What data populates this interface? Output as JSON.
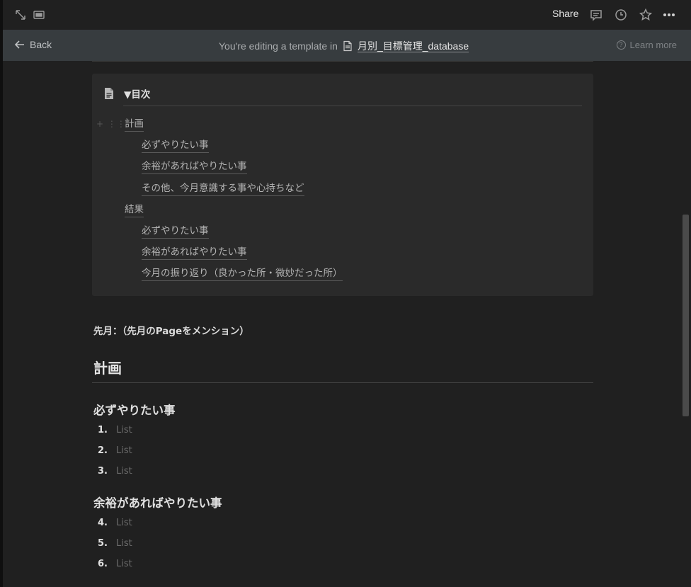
{
  "topbar": {
    "share_label": "Share",
    "icons": [
      "expand-icon",
      "peek-mode-icon",
      "comment-icon",
      "clock-icon",
      "star-icon",
      "more-icon"
    ]
  },
  "banner": {
    "back_label": "Back",
    "editing_text": "You're editing a template in",
    "database_name": "月別_目標管理_database",
    "learn_more": "Learn more"
  },
  "toc": {
    "title": "▼目次",
    "items": [
      {
        "label": "計画",
        "level": 0
      },
      {
        "label": "必ずやりたい事",
        "level": 1
      },
      {
        "label": "余裕があればやりたい事",
        "level": 1
      },
      {
        "label": "その他、今月意識する事や心持ちなど",
        "level": 1
      },
      {
        "label": "結果",
        "level": 0
      },
      {
        "label": "必ずやりたい事",
        "level": 1
      },
      {
        "label": "余裕があればやりたい事",
        "level": 1
      },
      {
        "label": "今月の振り返り（良かった所・微妙だった所）",
        "level": 1
      }
    ]
  },
  "mention_line": "先月：（先月のPageをメンション）",
  "section_heading": "計画",
  "subsections": [
    {
      "title": "必ずやりたい事",
      "items": [
        {
          "num": "1.",
          "text": "List"
        },
        {
          "num": "2.",
          "text": "List"
        },
        {
          "num": "3.",
          "text": "List"
        }
      ]
    },
    {
      "title": "余裕があればやりたい事",
      "items": [
        {
          "num": "4.",
          "text": "List"
        },
        {
          "num": "5.",
          "text": "List"
        },
        {
          "num": "6.",
          "text": "List"
        }
      ]
    }
  ]
}
